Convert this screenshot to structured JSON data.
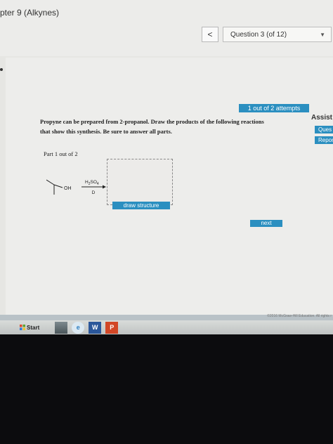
{
  "header": {
    "chapter_title": "pter 9 (Alkynes)",
    "prev_symbol": "<",
    "question_label": "Question 3 (of 12)"
  },
  "sidebar": {
    "attempts": "1 out of 2 attempts",
    "assist_label": "Assist",
    "question_btn": "Ques",
    "report_btn": "Repor"
  },
  "question": {
    "line1": "Propyne can be prepared from 2-propanol. Draw the products of the following reactions",
    "line2": "that show this synthesis. Be sure to answer all parts.",
    "part_label": "Part 1 out of 2"
  },
  "reaction": {
    "oh_label": "OH",
    "reagent": "H2SO4",
    "condition": "D"
  },
  "buttons": {
    "draw_structure": "draw structure",
    "next": "next"
  },
  "footer": {
    "copyright": "©2016 McGraw-Hill Education. All rights r"
  },
  "taskbar": {
    "start": "Start",
    "word_letter": "W",
    "ppt_letter": "P"
  }
}
